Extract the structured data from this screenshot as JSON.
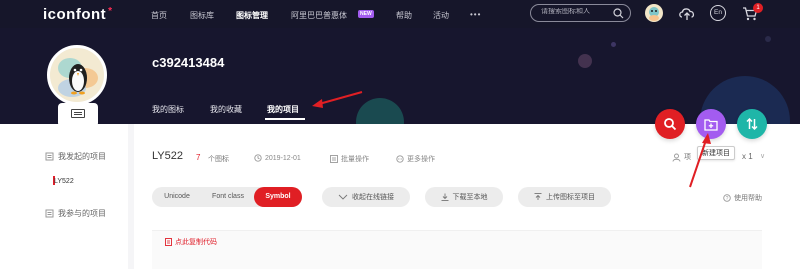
{
  "nav": {
    "logo_text": "iconfont",
    "logo_star": "*",
    "items": [
      "首页",
      "图标库",
      "图标管理",
      "阿里巴巴普惠体",
      "帮助",
      "活动",
      "•••"
    ],
    "active_item": "图标管理",
    "new_badge": "NEW",
    "search_placeholder": "请搜索图标和人",
    "lang_label": "En",
    "cart_count": "1"
  },
  "profile": {
    "username": "c392413484",
    "tabs": [
      "我的图标",
      "我的收藏",
      "我的项目"
    ],
    "active_tab": "我的项目"
  },
  "sidebar": {
    "section1": "我发起的项目",
    "project": "LY522",
    "section2": "我参与的项目"
  },
  "project": {
    "name": "LY522",
    "icon_count": "7",
    "icon_count_label": "个图标",
    "date": "2019-12-01",
    "batch_label": "批量操作",
    "more_label": "更多操作",
    "right_label": "项",
    "size_label": "x 1"
  },
  "format_tabs": [
    "Unicode",
    "Font class",
    "Symbol"
  ],
  "active_format": "Symbol",
  "actions": {
    "collect_link": "收起在线链接",
    "download": "下载至本地",
    "upload": "上传图标至项目",
    "help": "使用帮助",
    "copy_code": "点此复制代码",
    "new_project_tooltip": "新建项目"
  },
  "colors": {
    "nav_bg": "#16162a",
    "banner_bg": "#17162e",
    "accent_red": "#e01f24",
    "fab_purple": "#a35cf0",
    "fab_teal": "#1fb6a8"
  }
}
